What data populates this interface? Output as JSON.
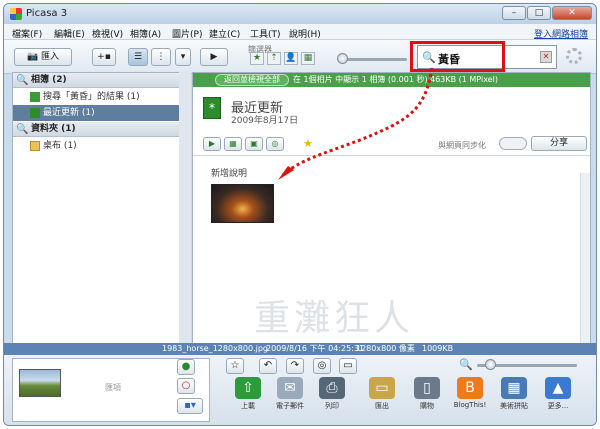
{
  "window": {
    "title": "Picasa 3",
    "min_label": "–",
    "max_label": "□",
    "close_label": "✕"
  },
  "menu": {
    "items": [
      "檔案(F)",
      "編輯(E)",
      "檢視(V)",
      "相簿(A)",
      "圖片(P)",
      "建立(C)",
      "工具(T)",
      "說明(H)"
    ],
    "login": "登入網路相簿"
  },
  "toolbar": {
    "import_label": "匯入",
    "filter_label": "篩選器",
    "search_query": "黃昏"
  },
  "sidebar": {
    "albums_header": "相簿 (2)",
    "albums": [
      {
        "label": "搜尋「黃昏」的結果 (1)",
        "selected": false
      },
      {
        "label": "最近更新 (1)",
        "selected": true
      }
    ],
    "folders_header": "資料夾 (1)",
    "folders": [
      {
        "label": "桌布 (1)",
        "selected": false
      }
    ]
  },
  "main": {
    "back_label": "返回並檢視全部",
    "info": "在 1個相片 中顯示 1 相簿 (0.001 秒) 463KB (1 MPixel)",
    "album_title": "最近更新",
    "album_date": "2009年8月17日",
    "sync_label": "與網頁同步化",
    "share_label": "分享",
    "caption": "新增說明",
    "watermark": "重灘狂人"
  },
  "status": {
    "filename": "1983_horse_1280x800.jpg",
    "datetime": "2009/8/16 下午 04:25:31",
    "dims": "1280x800 像素",
    "size": "1009KB"
  },
  "tray": {
    "label": "匯項"
  },
  "actions": [
    {
      "label": "上載",
      "icon": "upload-icon",
      "color": "#2e9b3a"
    },
    {
      "label": "電子郵件",
      "icon": "email-icon",
      "color": "#7a8a9a"
    },
    {
      "label": "列印",
      "icon": "print-icon",
      "color": "#556677"
    },
    {
      "label": "匯出",
      "icon": "export-folder-icon",
      "color": "#c9a64a"
    },
    {
      "label": "購物",
      "icon": "shop-icon",
      "color": "#6a7a8a"
    },
    {
      "label": "BlogThis!",
      "icon": "blogger-icon",
      "color": "#f07a1a"
    },
    {
      "label": "美術拼貼",
      "icon": "collage-icon",
      "color": "#4a7ab5"
    },
    {
      "label": "更多...",
      "icon": "more-icon",
      "color": "#3a7ad0"
    }
  ]
}
